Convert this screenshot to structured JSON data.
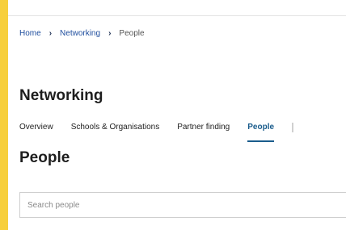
{
  "breadcrumb": {
    "items": [
      "Home",
      "Networking",
      "People"
    ],
    "separator": "›"
  },
  "section": {
    "title": "Networking"
  },
  "tabs": [
    {
      "label": "Overview",
      "active": false
    },
    {
      "label": "Schools & Organisations",
      "active": false
    },
    {
      "label": "Partner finding",
      "active": false
    },
    {
      "label": "People",
      "active": true
    }
  ],
  "page": {
    "title": "People"
  },
  "search": {
    "placeholder": "Search people",
    "value": ""
  },
  "colors": {
    "background": "#f7cf3b",
    "link": "#1f4e9e",
    "active_tab": "#1a5c8c"
  }
}
